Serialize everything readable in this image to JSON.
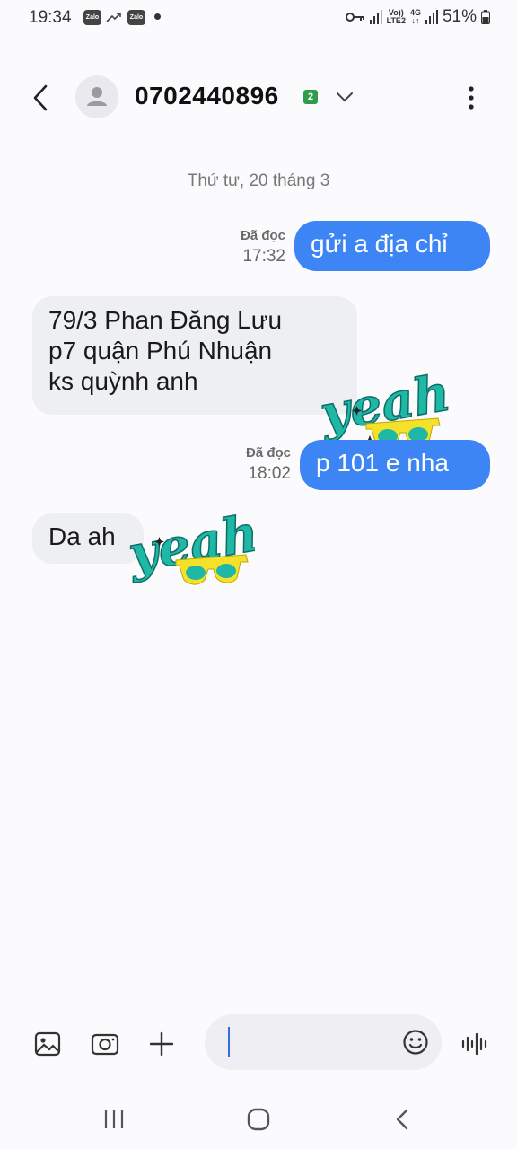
{
  "status_bar": {
    "time": "19:34",
    "zalo_label": "Zalo",
    "volte": "Vo))",
    "lte": "LTE2",
    "network": "4G",
    "battery": "51%"
  },
  "header": {
    "contact": "0702440896",
    "sim": "2"
  },
  "conversation": {
    "date": "Thứ tư, 20 tháng 3",
    "messages": [
      {
        "direction": "out",
        "text": "gửi a địa chỉ",
        "status": "Đã đọc",
        "time": "17:32"
      },
      {
        "direction": "in",
        "lines": [
          "79/3 Phan Đăng Lưu",
          "p7 quận Phú Nhuận",
          "ks quỳnh anh"
        ]
      },
      {
        "direction": "out",
        "text": "p 101 e nha",
        "status": "Đã đọc",
        "time": "18:02"
      },
      {
        "direction": "in",
        "text": "Da ah"
      }
    ]
  },
  "stickers": [
    {
      "name": "yeah-sticker",
      "text": "yeah"
    },
    {
      "name": "yeah-sticker",
      "text": "yeah"
    }
  ],
  "composer": {
    "input_value": ""
  },
  "icons": {
    "gallery": "image-icon",
    "camera": "camera-icon",
    "add": "plus-icon",
    "emoji": "emoji-icon",
    "voice": "voice-icon",
    "nav_recents": "recents-icon",
    "nav_home": "home-icon",
    "nav_back": "back-icon"
  },
  "colors": {
    "outgoing_bubble": "#3d85f5",
    "incoming_bubble": "#eeeff3",
    "sticker_teal": "#1fb7a6",
    "sticker_yellow": "#f5e02a"
  }
}
